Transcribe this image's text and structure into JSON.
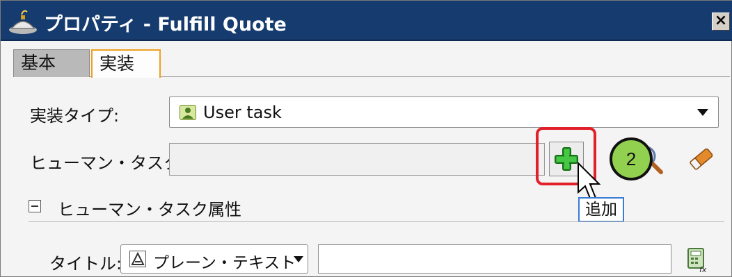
{
  "window": {
    "title": "プロパティ - Fulfill Quote",
    "close_label": "×",
    "app_icon": "teapot-app-icon"
  },
  "tabs": [
    {
      "label": "基本",
      "active": false
    },
    {
      "label": "実装",
      "active": true
    }
  ],
  "impl_type": {
    "label": "実装タイプ:",
    "value": "User task",
    "icon": "user-task-icon"
  },
  "human_task": {
    "label": "ヒューマン・タスク:",
    "value": "",
    "add_icon": "green-plus-icon",
    "search_icon": "magnifier-icon",
    "clear_icon": "eraser-icon",
    "add_tooltip": "追加",
    "step_badge": "2"
  },
  "section": {
    "title": "ヒューマン・タスク属性",
    "expanded": true
  },
  "title_field": {
    "label": "タイトル:",
    "format_value": "プレーン・テキスト",
    "text_value": "",
    "expression_icon": "calculator-fx-icon"
  },
  "colors": {
    "titlebar": "#163b6e",
    "highlight": "#e2202a",
    "badge": "#92d050",
    "tooltip_border": "#3a7bd5"
  }
}
